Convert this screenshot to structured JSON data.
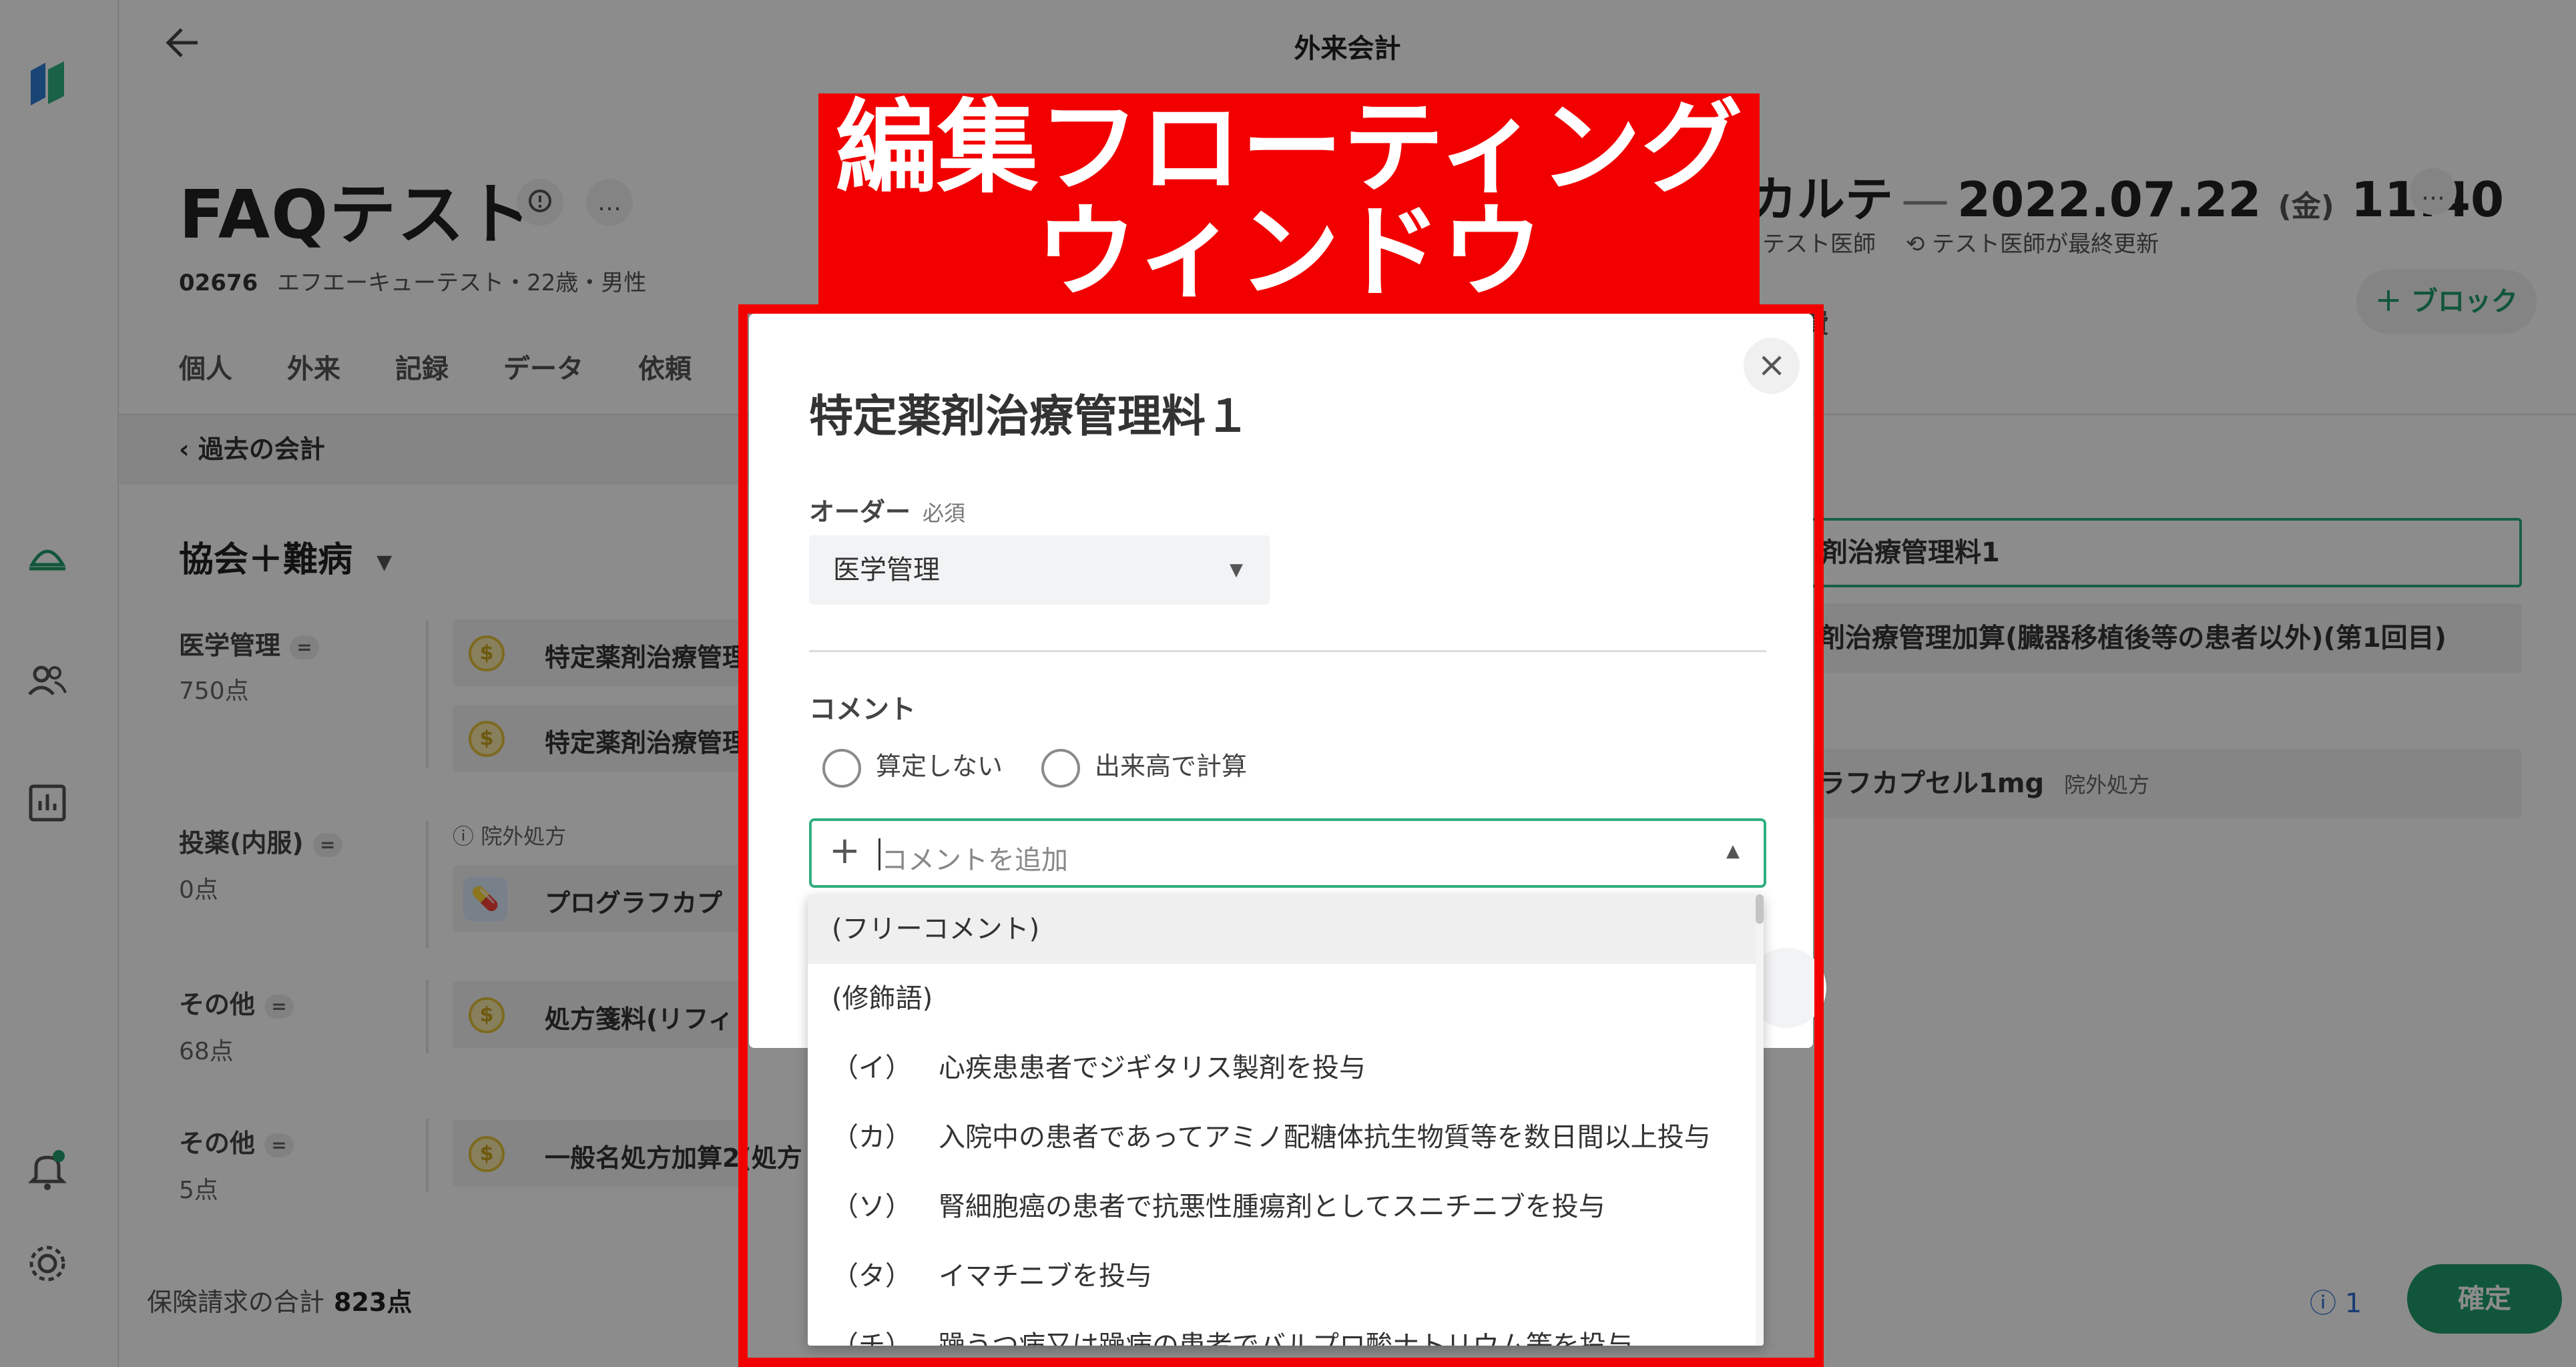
{
  "page": {
    "title": "外来会計"
  },
  "nav": {
    "logo": "clinic-logo",
    "icons": [
      "reception-bell-icon",
      "patients-icon",
      "stats-chart-icon",
      "notification-bell-icon",
      "settings-gear-icon"
    ]
  },
  "patient": {
    "name": "FAQテスト",
    "id": "02676",
    "meta": "エフエーキューテスト・22歳・男性",
    "tabs": [
      "個人",
      "外来",
      "記録",
      "データ",
      "依頼"
    ],
    "past_bills": "過去の会計",
    "insurance": "協会＋難病",
    "more": "…"
  },
  "billing": {
    "categories": [
      {
        "label": "医学管理",
        "points": "750点"
      },
      {
        "label": "投薬(内服)",
        "points": "0点",
        "note": "院外処方"
      },
      {
        "label": "その他",
        "points": "68点"
      },
      {
        "label": "その他",
        "points": "5点"
      }
    ],
    "items": [
      "特定薬剤治療管理",
      "特定薬剤治療管理",
      "プログラフカプ",
      "処方箋料(リフィ",
      "一般名処方加算2(処方"
    ],
    "equal_sign": "="
  },
  "footer": {
    "total_label": "保険請求の合計",
    "total_value": "823点"
  },
  "karte": {
    "title": "カルテ",
    "date": "2022.07.22",
    "dow": "(金)",
    "time": "11:40",
    "doctor": "テスト医師",
    "updated_by": "テスト医師が最終更新",
    "add_block": "＋ ブロック",
    "fee_tab": "費",
    "rows": [
      "剤治療管理料1",
      "剤治療管理加算(臓器移植後等の患者以外)(第1回目)",
      "ラフカプセル1mg"
    ],
    "row3_note": "院外処方",
    "info_count": "ⓘ 1",
    "confirm": "確定"
  },
  "callout": {
    "line1": "編集フローティング",
    "line2": "ウィンドウ"
  },
  "modal": {
    "title": "特定薬剤治療管理料１",
    "order_label": "オーダー",
    "order_required": "必須",
    "order_value": "医学管理",
    "comment_label": "コメント",
    "radio1": "算定しない",
    "radio2": "出来高で計算",
    "comment_placeholder": "コメントを追加",
    "close": "×"
  },
  "dropdown": {
    "options": [
      {
        "code": "",
        "text": "(フリーコメント)"
      },
      {
        "code": "",
        "text": "(修飾語)"
      },
      {
        "code": "（イ）",
        "text": "心疾患患者でジギタリス製剤を投与"
      },
      {
        "code": "（カ）",
        "text": "入院中の患者であってアミノ配糖体抗生物質等を数日間以上投与"
      },
      {
        "code": "（ソ）",
        "text": "腎細胞癌の患者で抗悪性腫瘍剤としてスニチニブを投与"
      },
      {
        "code": "（タ）",
        "text": "イマチニブを投与"
      },
      {
        "code": "（チ）",
        "text": "躁うつ病又は躁病の患者でバルプロ酸ナトリウム等を投与"
      }
    ]
  }
}
